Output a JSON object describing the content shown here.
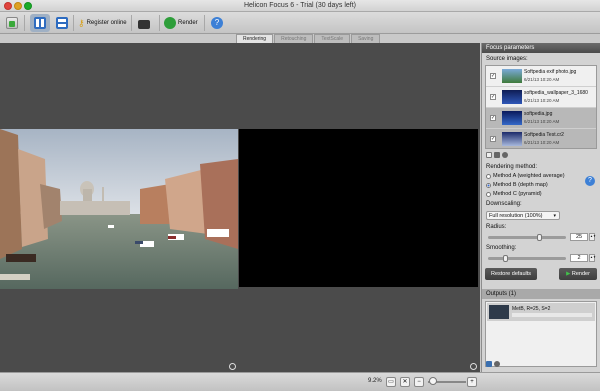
{
  "window": {
    "title": "Helicon Focus 6 - Trial (30 days left)"
  },
  "toolbar": {
    "register_label": "Register online",
    "render_label": "Render"
  },
  "tabs": [
    {
      "label": "Rendering",
      "active": true
    },
    {
      "label": "Retouching",
      "active": false
    },
    {
      "label": "TextScale",
      "active": false
    },
    {
      "label": "Saving",
      "active": false
    }
  ],
  "panel": {
    "title": "Focus parameters",
    "source_label": "Source images:",
    "sources": [
      {
        "name": "Softpedia exif photo.jpg",
        "date": "6/21/13 10:20 AM",
        "checked": true,
        "selected": false
      },
      {
        "name": "softpedia_wallpaper_3_1680",
        "date": "6/21/13 10:20 AM",
        "checked": true,
        "selected": false
      },
      {
        "name": "softpedia.jpg",
        "date": "6/21/13 10:20 AM",
        "checked": true,
        "selected": true
      },
      {
        "name": "Softpedia Test.cr2",
        "date": "6/21/13 10:20 AM",
        "checked": true,
        "selected": true
      }
    ],
    "rendering_method_label": "Rendering method:",
    "methods": [
      {
        "label": "Method A (weighted average)",
        "selected": false
      },
      {
        "label": "Method B (depth map)",
        "selected": true
      },
      {
        "label": "Method C (pyramid)",
        "selected": false
      }
    ],
    "downscaling_label": "Downscaling:",
    "downscaling_value": "Full resolution (100%)",
    "radius_label": "Radius:",
    "radius_value": "25",
    "radius_fraction": 0.67,
    "smoothing_label": "Smoothing:",
    "smoothing_value": "2",
    "smoothing_fraction": 0.2,
    "restore_label": "Restore defaults",
    "render_label": "Render",
    "outputs_label": "Outputs (1)",
    "output_item": "MetB, R=25, S=2"
  },
  "status": {
    "zoom": "9.2%"
  },
  "colors": {
    "accent": "#3d80d6",
    "viewer_bg": "#4b4b4b",
    "panel_bg": "#d3d3d3"
  }
}
